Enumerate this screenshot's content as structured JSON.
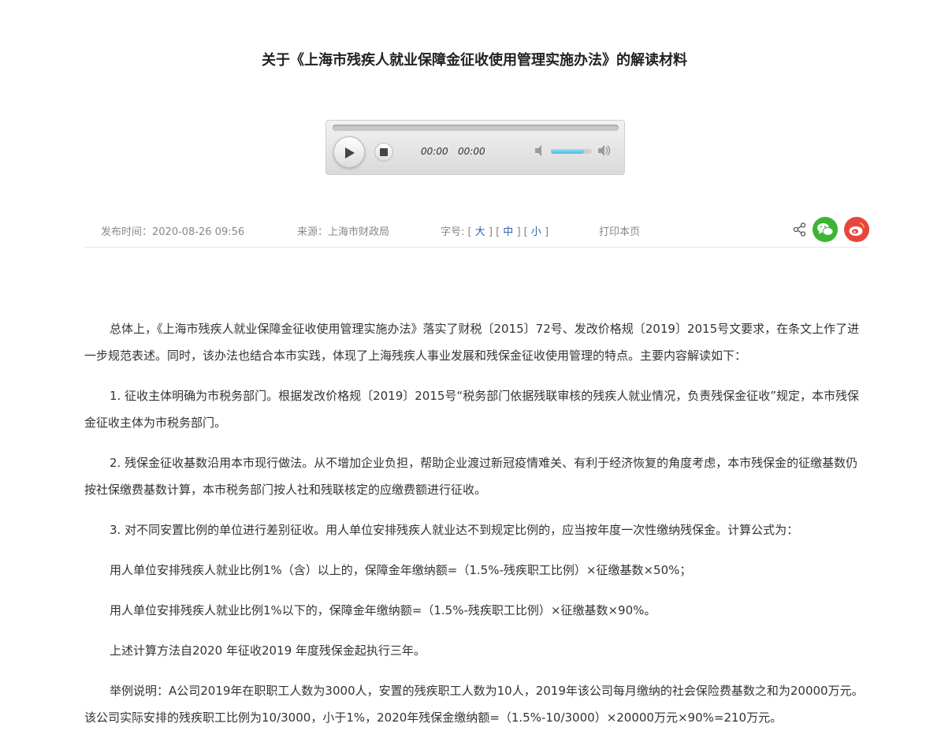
{
  "title": "关于《上海市残疾人就业保障金征收使用管理实施办法》的解读材料",
  "player": {
    "current_time": "00:00",
    "duration": "00:00",
    "progress": 0,
    "volume": 0.8
  },
  "meta": {
    "publish_time": "发布时间：2020-08-26 09:56",
    "source": "来源：上海市财政局",
    "font_size_label": "字号:",
    "font_large": "大",
    "font_medium": "中",
    "font_small": "小",
    "print": "打印本页"
  },
  "share": {
    "icons": [
      "share-icon",
      "wechat-icon",
      "weibo-icon"
    ],
    "wechat_color": "#3bb534",
    "weibo_color": "#e8453c"
  },
  "article": {
    "paragraphs": [
      "总体上，《上海市残疾人就业保障金征收使用管理实施办法》落实了财税〔2015〕72号、发改价格规〔2019〕2015号文要求，在条文上作了进一步规范表述。同时，该办法也结合本市实践，体现了上海残疾人事业发展和残保金征收使用管理的特点。主要内容解读如下：",
      "1. 征收主体明确为市税务部门。根据发改价格规〔2019〕2015号“税务部门依据残联审核的残疾人就业情况，负责残保金征收”规定，本市残保金征收主体为市税务部门。",
      "2. 残保金征收基数沿用本市现行做法。从不增加企业负担，帮助企业渡过新冠疫情难关、有利于经济恢复的角度考虑，本市残保金的征缴基数仍按社保缴费基数计算，本市税务部门按人社和残联核定的应缴费额进行征收。",
      "3. 对不同安置比例的单位进行差别征收。用人单位安排残疾人就业达不到规定比例的，应当按年度一次性缴纳残保金。计算公式为：",
      "用人单位安排残疾人就业比例1%（含）以上的，保障金年缴纳额=（1.5%-残疾职工比例）×征缴基数×50%；",
      "用人单位安排残疾人就业比例1%以下的，保障金年缴纳额=（1.5%-残疾职工比例）×征缴基数×90%。",
      "上述计算方法自2020 年征收2019 年度残保金起执行三年。",
      "举例说明：A公司2019年在职职工人数为3000人，安置的残疾职工人数为10人，2019年该公司每月缴纳的社会保险费基数之和为20000万元。该公司实际安排的残疾职工比例为10/3000，小于1%，2020年残保金缴纳额=（1.5%-10/3000）×20000万元×90%=210万元。"
    ]
  }
}
